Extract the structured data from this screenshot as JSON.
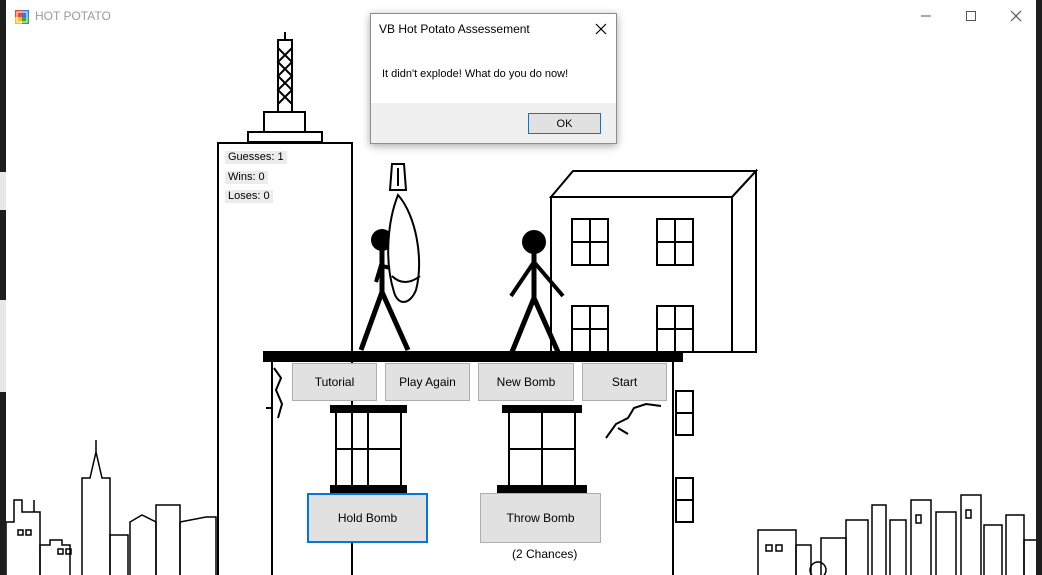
{
  "window": {
    "title": "HOT POTATO"
  },
  "stats": {
    "guesses": "Guesses: 1",
    "wins": "Wins: 0",
    "loses": "Loses: 0"
  },
  "buttons": {
    "tutorial": "Tutorial",
    "play_again": "Play Again",
    "new_bomb": "New Bomb",
    "start": "Start",
    "hold_bomb": "Hold Bomb",
    "throw_bomb": "Throw Bomb"
  },
  "chances_text": "(2 Chances)",
  "dialog": {
    "title": "VB Hot Potato Assessement",
    "message": "It didn't explode! What do you do now!",
    "ok": "OK"
  },
  "colors": {
    "focus_accent": "#0078d7",
    "button_face": "#e1e1e1",
    "dialog_footer": "#f0f0f0"
  }
}
